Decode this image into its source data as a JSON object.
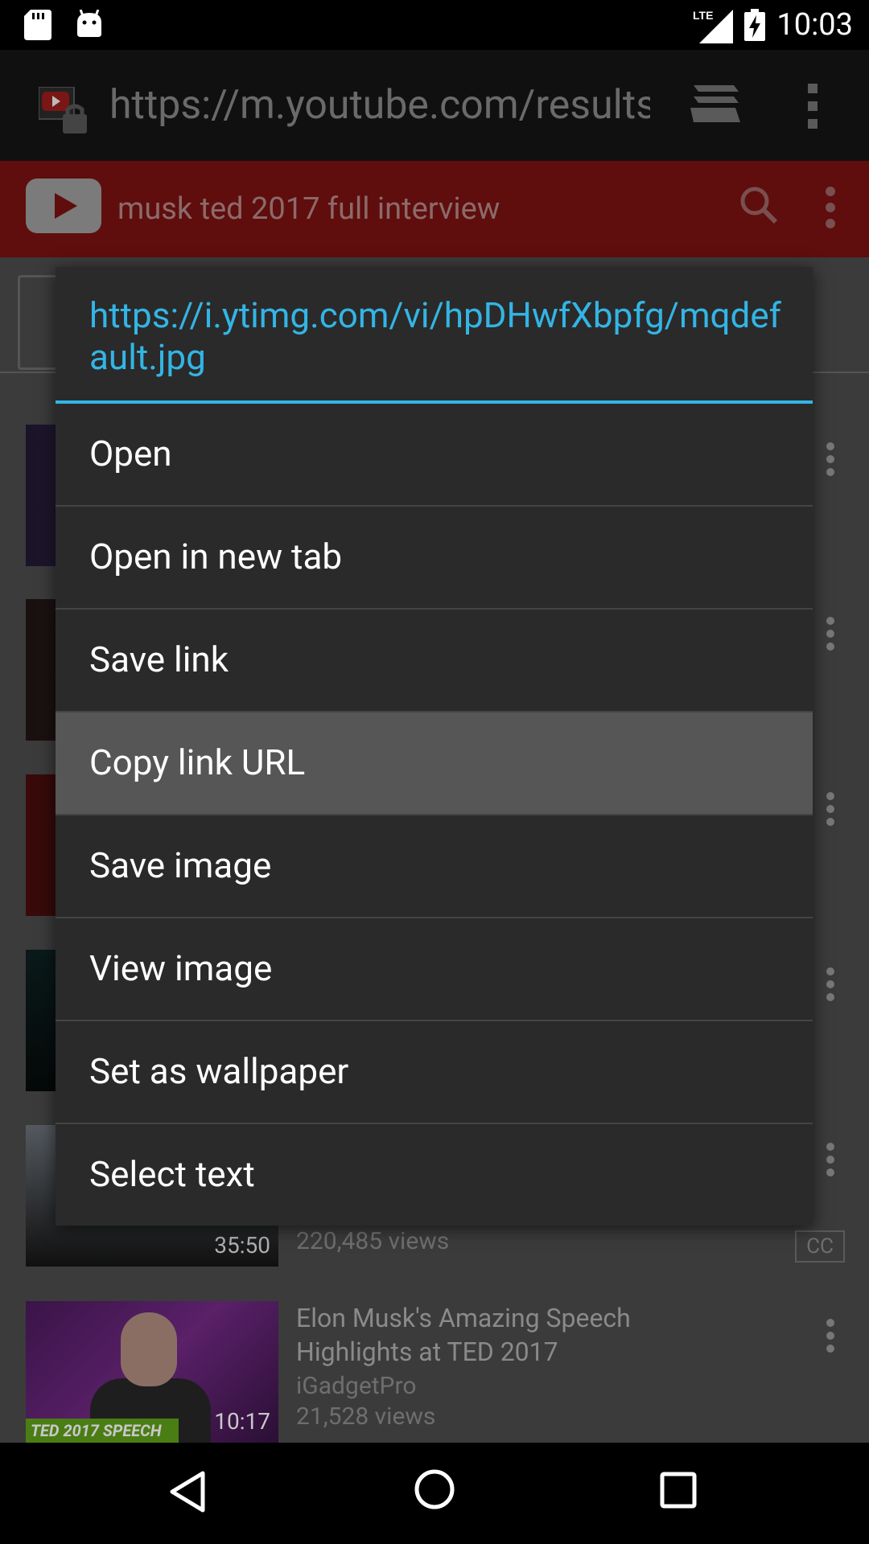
{
  "status_bar": {
    "time": "10:03",
    "network": "LTE"
  },
  "browser": {
    "url": "https://m.youtube.com/results?q",
    "icons": [
      "youtube-lock-site-icon",
      "tabs-icon",
      "overflow-menu-icon"
    ]
  },
  "youtube_header": {
    "search_query": "musk ted 2017 full interview",
    "icons": [
      "youtube-logo",
      "search-icon",
      "more-vert-icon"
    ]
  },
  "results": {
    "partial_row": {
      "duration": "35:50",
      "views": "220,485 views",
      "badge": "CC"
    },
    "last_row": {
      "title": "Elon Musk's Amazing Speech Highlights at TED 2017",
      "channel": "iGadgetPro",
      "views": "21,528 views",
      "duration": "10:17",
      "thumb_banner": "TED 2017 SPEECH"
    }
  },
  "context_menu": {
    "title": "https://i.ytimg.com/vi/hpDHwfXbpfg/mqdefault.jpg",
    "items": [
      {
        "label": "Open"
      },
      {
        "label": "Open in new tab"
      },
      {
        "label": "Save link"
      },
      {
        "label": "Copy link URL"
      },
      {
        "label": "Save image"
      },
      {
        "label": "View image"
      },
      {
        "label": "Set as wallpaper"
      },
      {
        "label": "Select text"
      }
    ],
    "highlighted_item": "Copy link URL",
    "accent_color": "#33b5e5"
  },
  "colors": {
    "youtube_red_dimmed": "#5f0d0d",
    "dialog_bg": "#2a2a2a",
    "highlight_bg": "#565656"
  }
}
